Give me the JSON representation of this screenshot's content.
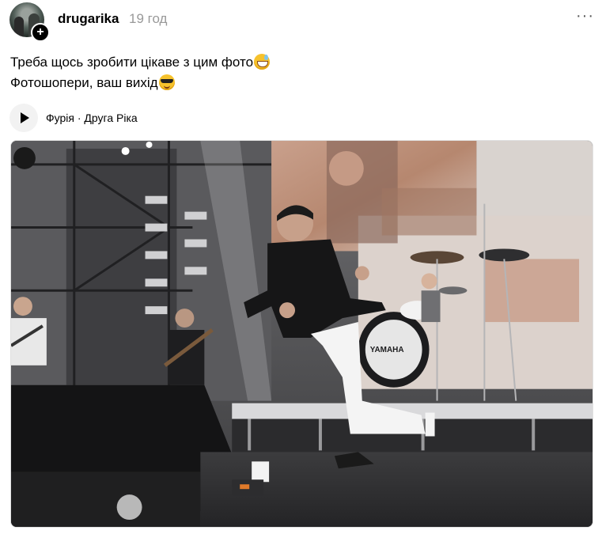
{
  "post": {
    "username": "drugarika",
    "timestamp": "19 год",
    "more_icon": "more-horizontal-icon",
    "caption_lines": [
      "Треба щось зробити цікаве з цим фото",
      "Фотошопери, ваш вихід"
    ],
    "caption_emojis": [
      "grinning-face-with-sweat",
      "smiling-face-with-sunglasses"
    ],
    "music": {
      "label": "Фурія · Друга Ріка",
      "icon": "play-icon"
    },
    "photo": {
      "subject": "concert-stage-photo",
      "drum_brand": "YAMAHA"
    }
  }
}
